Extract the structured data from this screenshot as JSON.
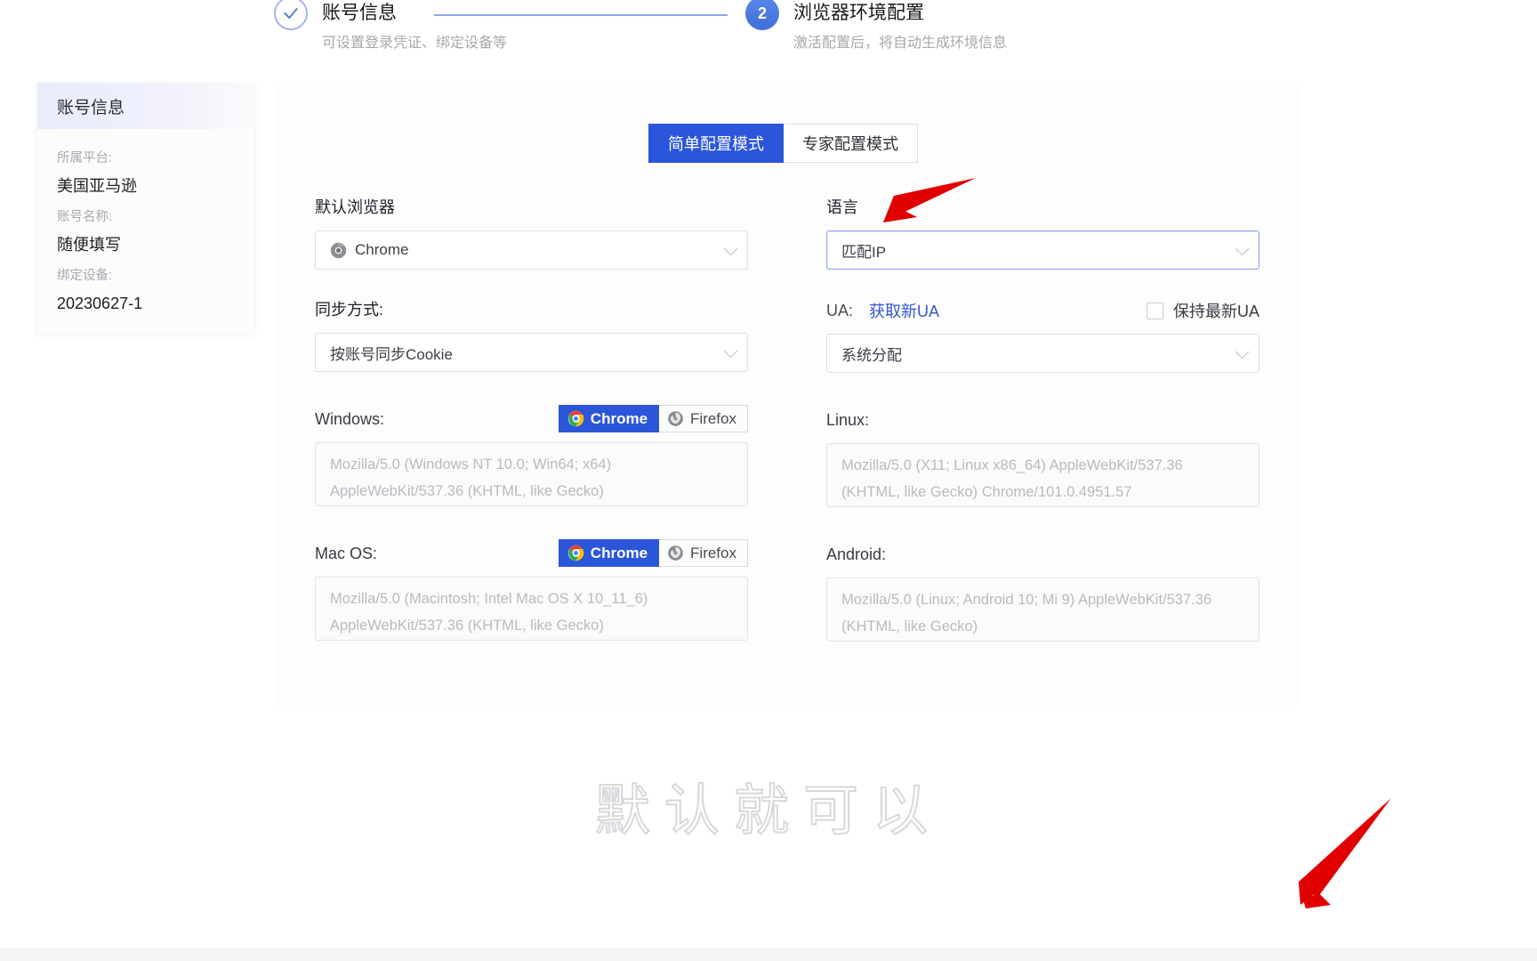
{
  "stepper": {
    "step1": {
      "title": "账号信息",
      "subtitle": "可设置登录凭证、绑定设备等",
      "badge": "✓"
    },
    "step2": {
      "title": "浏览器环境配置",
      "subtitle": "激活配置后，将自动生成环境信息",
      "badge": "2"
    }
  },
  "sidebar": {
    "header": "账号信息",
    "fields": [
      {
        "label": "所属平台:",
        "value": "美国亚马逊"
      },
      {
        "label": "账号名称:",
        "value": "随便填写"
      },
      {
        "label": "绑定设备:",
        "value": "20230627-1"
      }
    ]
  },
  "mode_tabs": [
    {
      "label": "简单配置模式",
      "selected": true
    },
    {
      "label": "专家配置模式",
      "selected": false
    }
  ],
  "form": {
    "default_browser": {
      "label": "默认浏览器",
      "value": "Chrome",
      "icon": "chrome-icon"
    },
    "language": {
      "label": "语言",
      "value": "匹配IP"
    },
    "sync_mode": {
      "label": "同步方式:",
      "value": "按账号同步Cookie"
    },
    "ua": {
      "label": "UA:",
      "refresh_link": "获取新UA",
      "keep_latest_label": "保持最新UA",
      "keep_latest_checked": false,
      "allocation_value": "系统分配"
    },
    "os_rows": [
      {
        "label": "Windows:",
        "has_toggle": true,
        "browsers": [
          {
            "label": "Chrome",
            "active": true
          },
          {
            "label": "Firefox",
            "active": false
          }
        ],
        "ua_text": "Mozilla/5.0 (Windows NT 10.0; Win64; x64) AppleWebKit/537.36 (KHTML, like Gecko)"
      },
      {
        "label": "Linux:",
        "has_toggle": false,
        "browsers": [],
        "ua_text": "Mozilla/5.0 (X11; Linux x86_64) AppleWebKit/537.36 (KHTML, like Gecko) Chrome/101.0.4951.57"
      },
      {
        "label": "Mac OS:",
        "has_toggle": true,
        "browsers": [
          {
            "label": "Chrome",
            "active": true
          },
          {
            "label": "Firefox",
            "active": false
          }
        ],
        "ua_text": "Mozilla/5.0 (Macintosh; Intel Mac OS X 10_11_6) AppleWebKit/537.36 (KHTML, like Gecko)"
      },
      {
        "label": "Android:",
        "has_toggle": false,
        "browsers": [],
        "ua_text": "Mozilla/5.0 (Linux; Android  10; Mi 9) AppleWebKit/537.36 (KHTML, like Gecko)"
      }
    ]
  },
  "annotations": {
    "watermark_text": "默认就可以",
    "arrow_color": "#e00000"
  },
  "colors": {
    "primary": "#2c56d9",
    "step_active": "#4b7ae0",
    "link": "#3355cc",
    "arrow_red": "#e00000"
  }
}
